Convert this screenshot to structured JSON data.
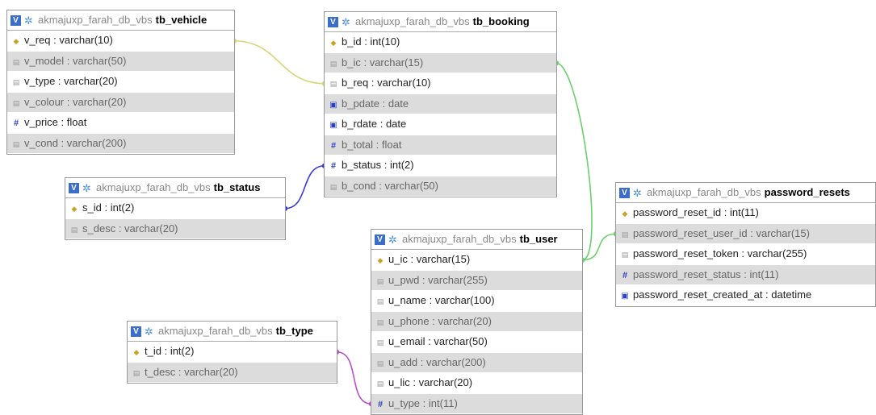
{
  "tables": [
    {
      "id": "tb_vehicle",
      "db": "akmajuxp_farah_db_vbs",
      "name": "tb_vehicle",
      "columns": [
        {
          "name": "v_req",
          "type": "varchar(10)",
          "icon": "key-icon"
        },
        {
          "name": "v_model",
          "type": "varchar(50)",
          "icon": "column-icon"
        },
        {
          "name": "v_type",
          "type": "varchar(20)",
          "icon": "column-icon"
        },
        {
          "name": "v_colour",
          "type": "varchar(20)",
          "icon": "column-icon"
        },
        {
          "name": "v_price",
          "type": "float",
          "icon": "numeric-icon"
        },
        {
          "name": "v_cond",
          "type": "varchar(200)",
          "icon": "column-icon"
        }
      ]
    },
    {
      "id": "tb_booking",
      "db": "akmajuxp_farah_db_vbs",
      "name": "tb_booking",
      "columns": [
        {
          "name": "b_id",
          "type": "int(10)",
          "icon": "key-icon"
        },
        {
          "name": "b_ic",
          "type": "varchar(15)",
          "icon": "column-icon"
        },
        {
          "name": "b_req",
          "type": "varchar(10)",
          "icon": "column-icon"
        },
        {
          "name": "b_pdate",
          "type": "date",
          "icon": "date-icon"
        },
        {
          "name": "b_rdate",
          "type": "date",
          "icon": "date-icon"
        },
        {
          "name": "b_total",
          "type": "float",
          "icon": "numeric-icon"
        },
        {
          "name": "b_status",
          "type": "int(2)",
          "icon": "numeric-icon"
        },
        {
          "name": "b_cond",
          "type": "varchar(50)",
          "icon": "column-icon"
        }
      ]
    },
    {
      "id": "tb_status",
      "db": "akmajuxp_farah_db_vbs",
      "name": "tb_status",
      "columns": [
        {
          "name": "s_id",
          "type": "int(2)",
          "icon": "key-icon"
        },
        {
          "name": "s_desc",
          "type": "varchar(20)",
          "icon": "column-icon"
        }
      ]
    },
    {
      "id": "password_resets",
      "db": "akmajuxp_farah_db_vbs",
      "name": "password_resets",
      "columns": [
        {
          "name": "password_reset_id",
          "type": "int(11)",
          "icon": "key-icon"
        },
        {
          "name": "password_reset_user_id",
          "type": "varchar(15)",
          "icon": "column-icon"
        },
        {
          "name": "password_reset_token",
          "type": "varchar(255)",
          "icon": "column-icon"
        },
        {
          "name": "password_reset_status",
          "type": "int(11)",
          "icon": "numeric-icon"
        },
        {
          "name": "password_reset_created_at",
          "type": "datetime",
          "icon": "date-icon"
        }
      ]
    },
    {
      "id": "tb_user",
      "db": "akmajuxp_farah_db_vbs",
      "name": "tb_user",
      "columns": [
        {
          "name": "u_ic",
          "type": "varchar(15)",
          "icon": "key-icon"
        },
        {
          "name": "u_pwd",
          "type": "varchar(255)",
          "icon": "column-icon"
        },
        {
          "name": "u_name",
          "type": "varchar(100)",
          "icon": "column-icon"
        },
        {
          "name": "u_phone",
          "type": "varchar(20)",
          "icon": "column-icon"
        },
        {
          "name": "u_email",
          "type": "varchar(50)",
          "icon": "column-icon"
        },
        {
          "name": "u_add",
          "type": "varchar(200)",
          "icon": "column-icon"
        },
        {
          "name": "u_lic",
          "type": "varchar(20)",
          "icon": "column-icon"
        },
        {
          "name": "u_type",
          "type": "int(11)",
          "icon": "numeric-icon"
        }
      ]
    },
    {
      "id": "tb_type",
      "db": "akmajuxp_farah_db_vbs",
      "name": "tb_type",
      "columns": [
        {
          "name": "t_id",
          "type": "int(2)",
          "icon": "key-icon"
        },
        {
          "name": "t_desc",
          "type": "varchar(20)",
          "icon": "column-icon"
        }
      ]
    }
  ],
  "relations": [
    {
      "from": "tb_vehicle.v_req",
      "to": "tb_booking.b_req",
      "color": "#d6d67a"
    },
    {
      "from": "tb_status.s_id",
      "to": "tb_booking.b_status",
      "color": "#3a3ad6"
    },
    {
      "from": "tb_booking.b_ic",
      "to": "tb_user.u_ic",
      "color": "#6bd06b"
    },
    {
      "from": "password_resets.password_reset_user_id",
      "to": "tb_user.u_ic",
      "color": "#6bd06b"
    },
    {
      "from": "tb_type.t_id",
      "to": "tb_user.u_type",
      "color": "#b84fc9"
    }
  ],
  "ui": {
    "toggle_label": "V",
    "settings_glyph": "✲"
  }
}
